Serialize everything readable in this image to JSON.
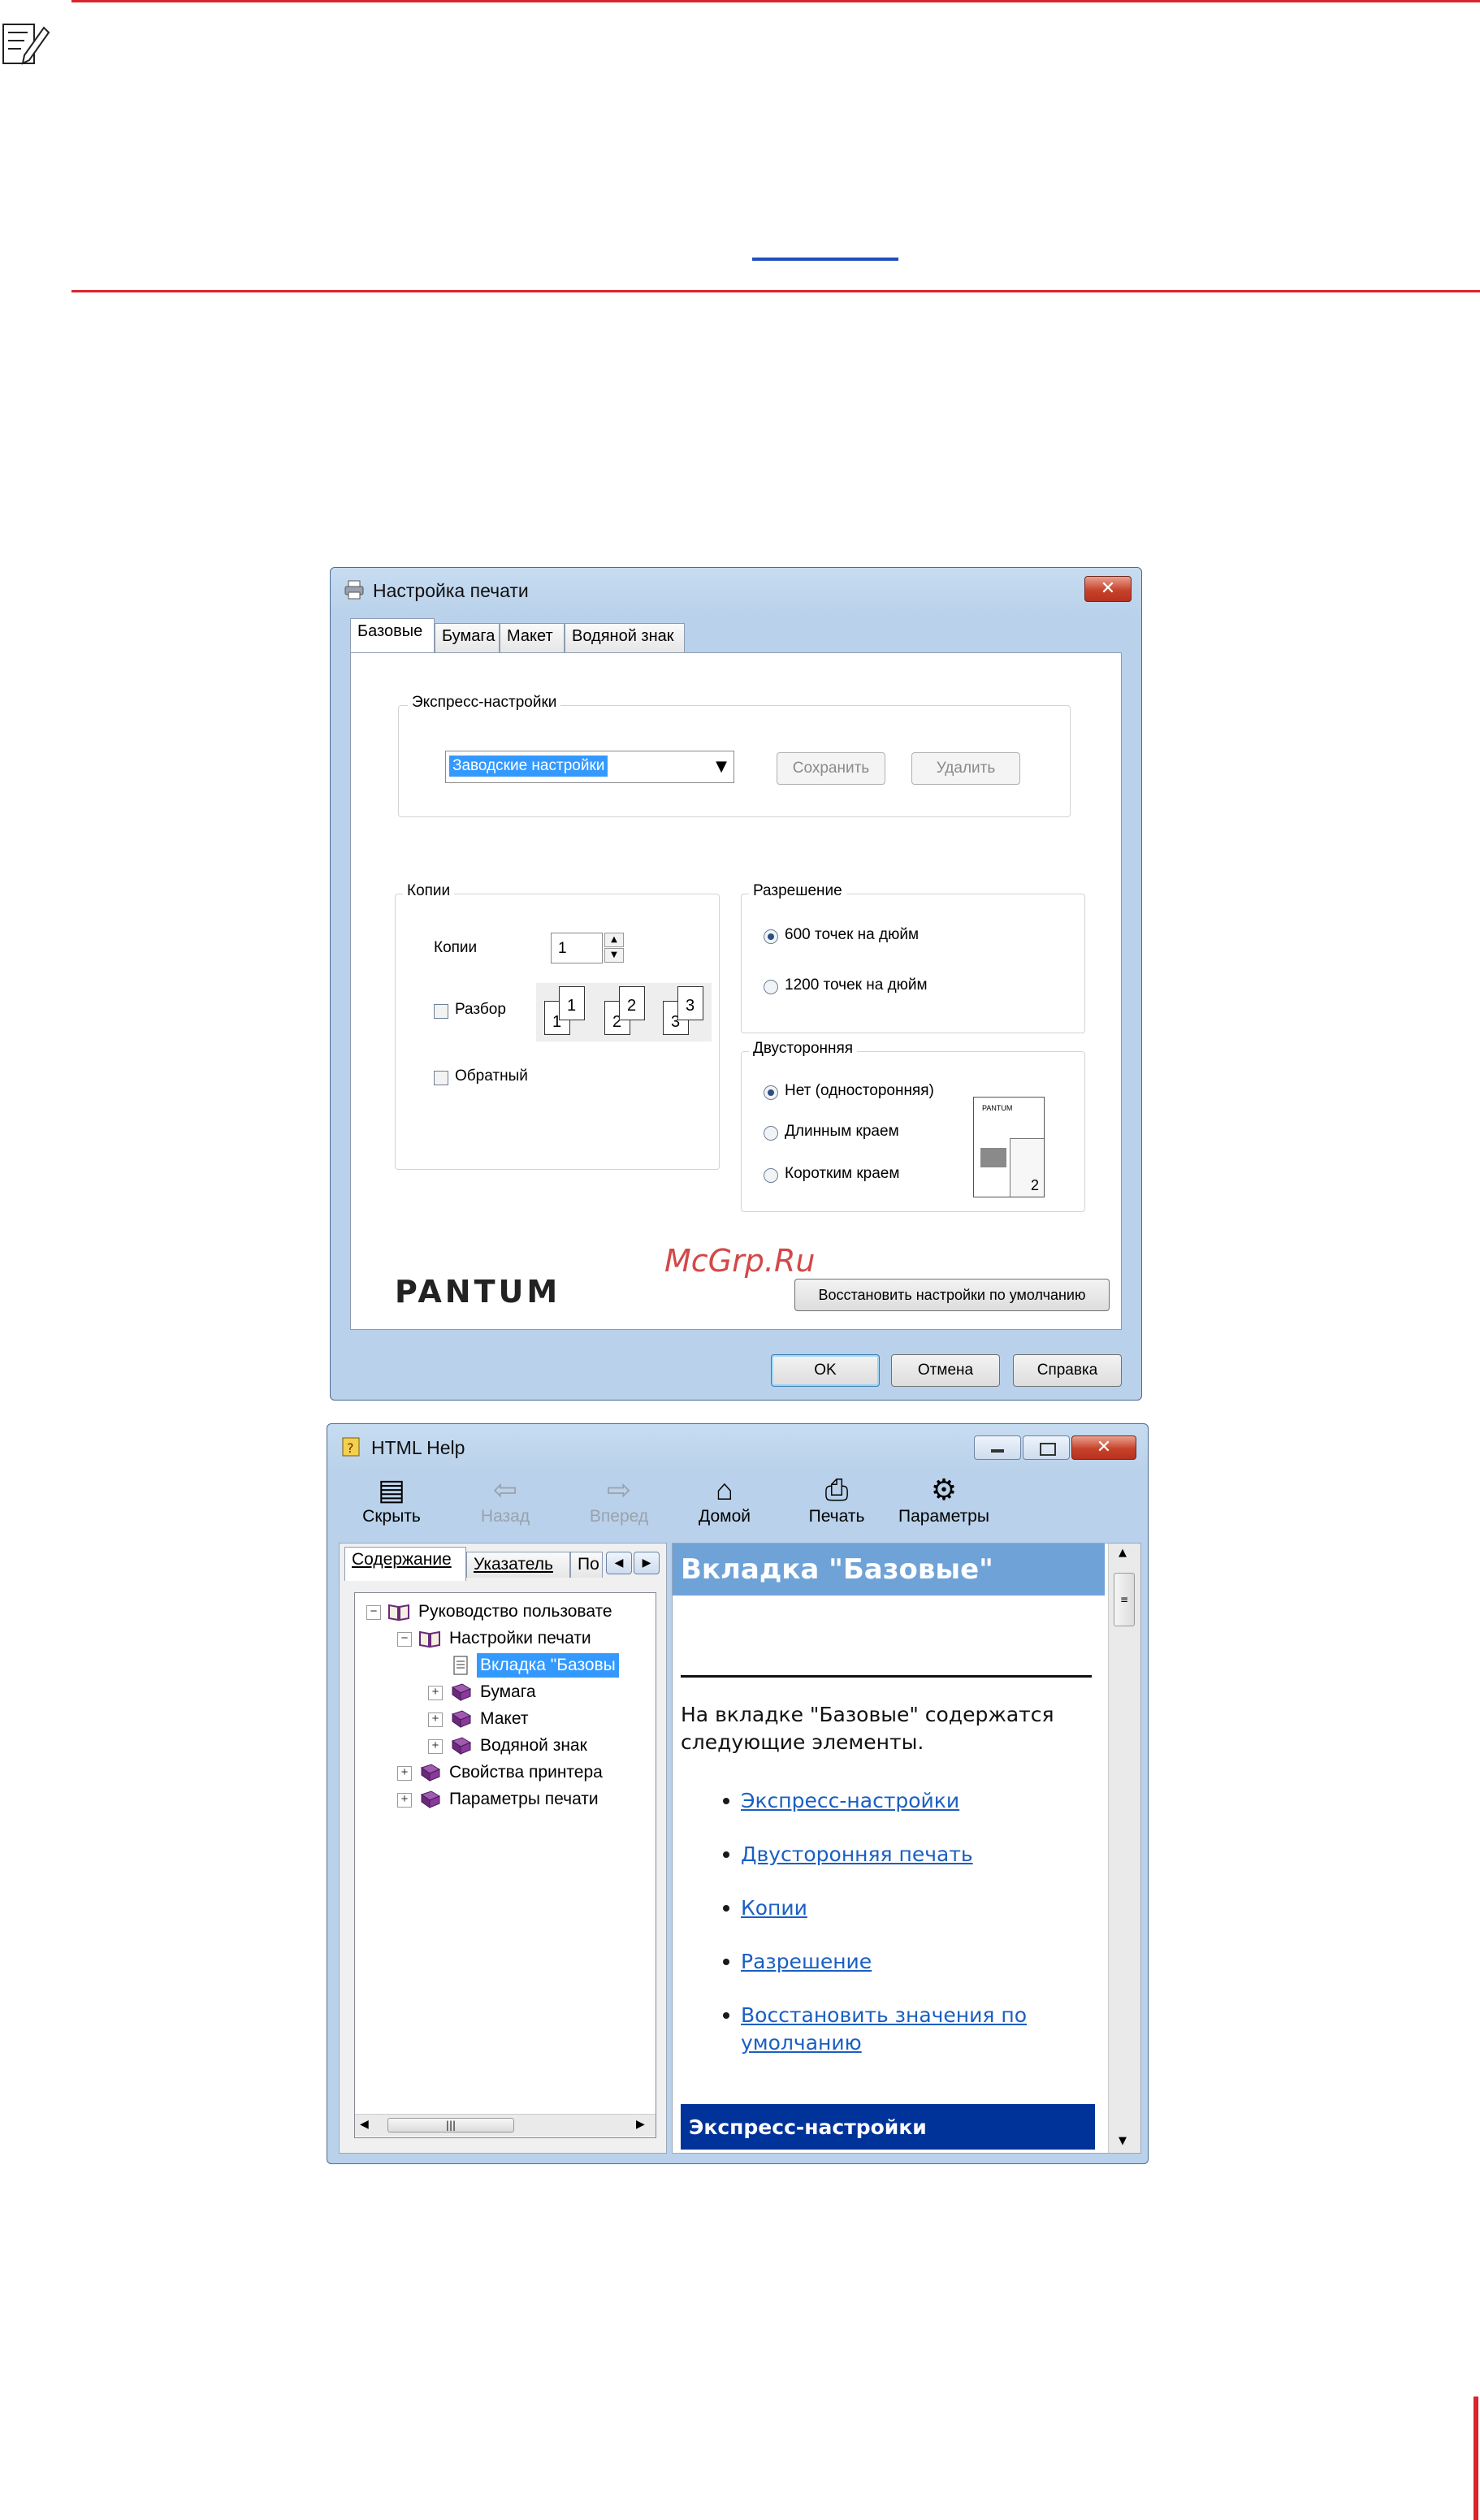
{
  "watermark": "McGrp.Ru",
  "print_dialog": {
    "title": "Настройка печати",
    "close_glyph": "✕",
    "tabs": [
      "Базовые",
      "Бумага",
      "Макет",
      "Водяной знак"
    ],
    "express": {
      "group_label": "Экспресс-настройки",
      "selected": "Заводские настройки",
      "save_label": "Сохранить",
      "delete_label": "Удалить"
    },
    "copies": {
      "group_label": "Копии",
      "copies_label": "Копии",
      "copies_value": "1",
      "collate_label": "Разбор",
      "collate_checked": false,
      "reverse_label": "Обратный",
      "reverse_checked": false,
      "collate_pages": [
        "1",
        "1",
        "2",
        "2",
        "3",
        "3"
      ]
    },
    "resolution": {
      "group_label": "Разрешение",
      "options": [
        "600 точек на дюйм",
        "1200 точек на дюйм"
      ],
      "selected_index": 0
    },
    "duplex": {
      "group_label": "Двусторонняя",
      "options": [
        "Нет (односторонняя)",
        "Длинным краем",
        "Коротким краем"
      ],
      "selected_index": 0,
      "preview_logo": "PANTUM",
      "preview_page": "2"
    },
    "brand": "PANTUM",
    "restore_label": "Восстановить настройки по умолчанию",
    "ok_label": "OK",
    "cancel_label": "Отмена",
    "help_label": "Справка"
  },
  "help_window": {
    "title": "HTML Help",
    "toolbar": [
      {
        "label": "Скрыть",
        "icon": "hide-icon",
        "glyph": "▤",
        "enabled": true
      },
      {
        "label": "Назад",
        "icon": "back-arrow-icon",
        "glyph": "⇦",
        "enabled": false
      },
      {
        "label": "Вперед",
        "icon": "forward-arrow-icon",
        "glyph": "⇨",
        "enabled": false
      },
      {
        "label": "Домой",
        "icon": "home-icon",
        "glyph": "⌂",
        "enabled": true
      },
      {
        "label": "Печать",
        "icon": "printer-icon",
        "glyph": "⎙",
        "enabled": true
      },
      {
        "label": "Параметры",
        "icon": "options-icon",
        "glyph": "⚙",
        "enabled": true
      }
    ],
    "nav_tabs": [
      "Содержание",
      "Указатель",
      "По"
    ],
    "tree": [
      {
        "label": "Руководство пользовате",
        "level": 0,
        "toggle": "−",
        "icon": "open-book-icon"
      },
      {
        "label": "Настройки печати",
        "level": 1,
        "toggle": "−",
        "icon": "open-book-icon"
      },
      {
        "label": "Вкладка \"Базовы",
        "level": 2,
        "toggle": "",
        "icon": "page-icon",
        "selected": true
      },
      {
        "label": "Бумага",
        "level": 2,
        "toggle": "+",
        "icon": "closed-book-icon"
      },
      {
        "label": "Макет",
        "level": 2,
        "toggle": "+",
        "icon": "closed-book-icon"
      },
      {
        "label": "Водяной знак",
        "level": 2,
        "toggle": "+",
        "icon": "closed-book-icon"
      },
      {
        "label": "Свойства принтера",
        "level": 1,
        "toggle": "+",
        "icon": "closed-book-icon"
      },
      {
        "label": "Параметры печати",
        "level": 1,
        "toggle": "+",
        "icon": "closed-book-icon"
      }
    ],
    "content": {
      "heading": "Вкладка \"Базовые\"",
      "intro": "На вкладке \"Базовые\" содержатся следующие элементы.",
      "links": [
        "Экспресс-настройки",
        "Двусторонняя печать",
        "Копии",
        "Разрешение",
        "Восстановить значения по умолчанию"
      ],
      "section_heading": "Экспресс-настройки"
    }
  },
  "colors": {
    "red_rule": "#d9252b",
    "link_blue": "#1a5fc2",
    "help_heading_bg": "#6fa3d8",
    "section_bg": "#003399",
    "selection_bg": "#3399ff"
  }
}
